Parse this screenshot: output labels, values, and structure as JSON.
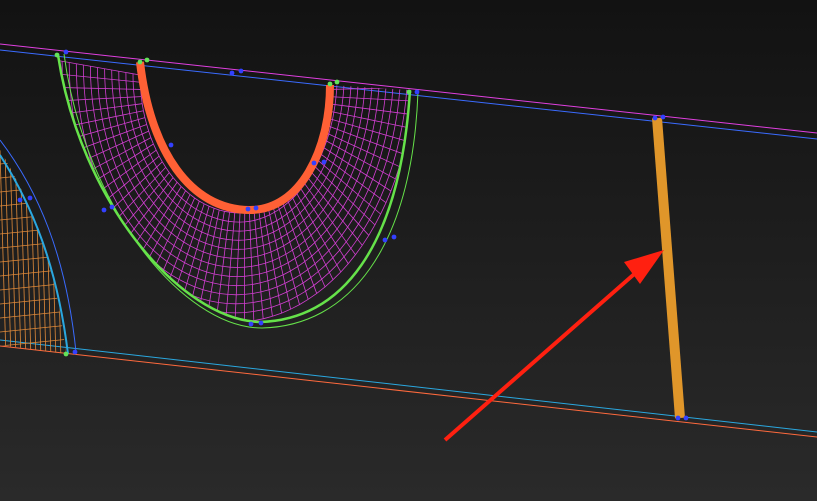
{
  "viewport": {
    "background_top": "#121212",
    "background_bottom": "#2a2a2a"
  },
  "colors": {
    "edge_magenta": "#e040e0",
    "edge_blue": "#3a6bff",
    "edge_orange": "#ff6a3d",
    "edge_cyan": "#2aa8e0",
    "mesh_magenta": "#d23fd2",
    "mesh_orange": "#e08a3a",
    "edge_green": "#66e24a",
    "highlight_edge": "#ff6035",
    "selected_edge": "#e0962a",
    "vertex": "#3340ff",
    "vertex_green": "#63e35a",
    "annotation_arrow": "#ff2010"
  },
  "icons": {
    "annotation": "arrow-pointer-icon"
  }
}
